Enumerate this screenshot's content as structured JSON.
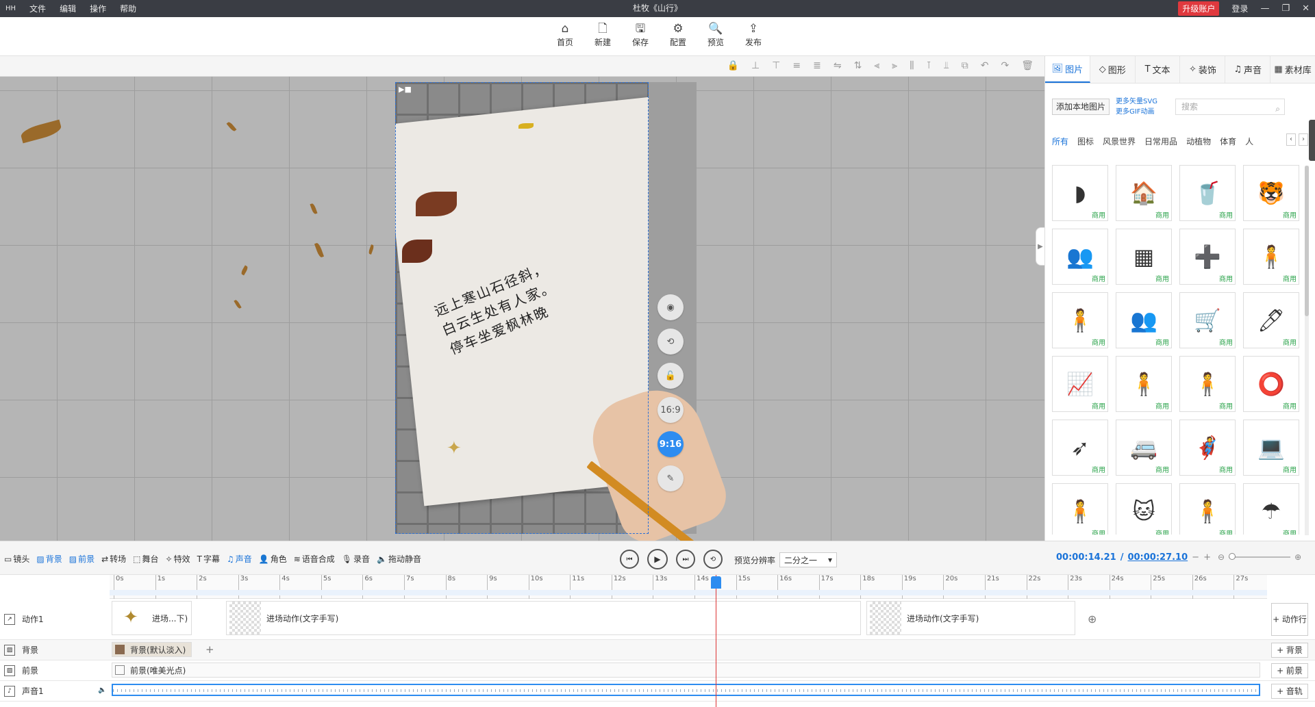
{
  "app_icon_text": "HH",
  "menu": [
    "文件",
    "编辑",
    "操作",
    "帮助"
  ],
  "window_title": "杜牧《山行》",
  "upgrade_label": "升级账户",
  "login_label": "登录",
  "window_controls": [
    "—",
    "❐",
    "✕"
  ],
  "toolbar": [
    {
      "label": "首页",
      "icon": "home-icon",
      "glyph": "⌂"
    },
    {
      "label": "新建",
      "icon": "new-file-icon",
      "glyph": "🗋"
    },
    {
      "label": "保存",
      "icon": "save-icon",
      "glyph": "🖫"
    },
    {
      "label": "配置",
      "icon": "config-icon",
      "glyph": "⚙"
    },
    {
      "label": "预览",
      "icon": "preview-icon",
      "glyph": "🔍"
    },
    {
      "label": "发布",
      "icon": "publish-icon",
      "glyph": "⇪"
    }
  ],
  "poem": [
    "远上寒山石径斜，",
    "白云生处有人家。",
    "停车坐爱枫林晚"
  ],
  "side_tools": [
    {
      "name": "camera-add-icon",
      "glyph": "◉"
    },
    {
      "name": "rotate-icon",
      "glyph": "⟲"
    },
    {
      "name": "lock-icon",
      "glyph": "🔓"
    },
    {
      "name": "ratio-16-9",
      "glyph": "16:9"
    },
    {
      "name": "ratio-9-16",
      "glyph": "9:16"
    },
    {
      "name": "edit-icon",
      "glyph": "✎"
    }
  ],
  "right_tabs": [
    "图片",
    "图形",
    "文本",
    "装饰",
    "声音",
    "素材库"
  ],
  "add_local_label": "添加本地图片",
  "more_svg": "更多矢量SVG",
  "more_gif": "更多GIF动画",
  "search_placeholder": "搜索",
  "categories": [
    "所有",
    "图标",
    "风景世界",
    "日常用品",
    "动植物",
    "体育",
    "人"
  ],
  "commercial_tag": "商用",
  "assets": [
    "◗",
    "🏠",
    "🥤",
    "🐯",
    "👥",
    "▦",
    "➕",
    "🧍",
    "🧍",
    "👥",
    "🛒",
    "🖊",
    "📈",
    "🧍",
    "🧍",
    "⭕",
    "➶",
    "🚐",
    "🦸",
    "💻",
    "🧍",
    "🐱",
    "🧍",
    "☂"
  ],
  "timeline_tools": [
    "镜头",
    "背景",
    "前景",
    "转场",
    "舞台",
    "特效",
    "字幕",
    "声音",
    "角色",
    "语音合成",
    "录音",
    "拖动静音"
  ],
  "preview_res_label": "预览分辨率",
  "preview_res_value": "二分之一",
  "time_current": "00:00:14.21",
  "time_total": "00:00:27.10",
  "ruler_ticks": [
    "0s",
    "1s",
    "2s",
    "3s",
    "4s",
    "5s",
    "6s",
    "7s",
    "8s",
    "9s",
    "10s",
    "11s",
    "12s",
    "13s",
    "14s",
    "15s",
    "16s",
    "17s",
    "18s",
    "19s",
    "20s",
    "21s",
    "22s",
    "23s",
    "24s",
    "25s",
    "26s",
    "27s"
  ],
  "tracks": {
    "action": {
      "label": "动作1",
      "clips": [
        "进场...下)",
        "进场动作(文字手写)",
        "进场动作(文字手写)"
      ],
      "add": "+ 动作行"
    },
    "background": {
      "label": "背景",
      "clip": "背景(默认淡入)",
      "add": "+ 背景"
    },
    "foreground": {
      "label": "前景",
      "clip": "前景(唯美光点)",
      "add": "+ 前景"
    },
    "sound": {
      "label": "声音1",
      "add": "+ 音轨"
    }
  },
  "accent_color": "#2d8cf0"
}
